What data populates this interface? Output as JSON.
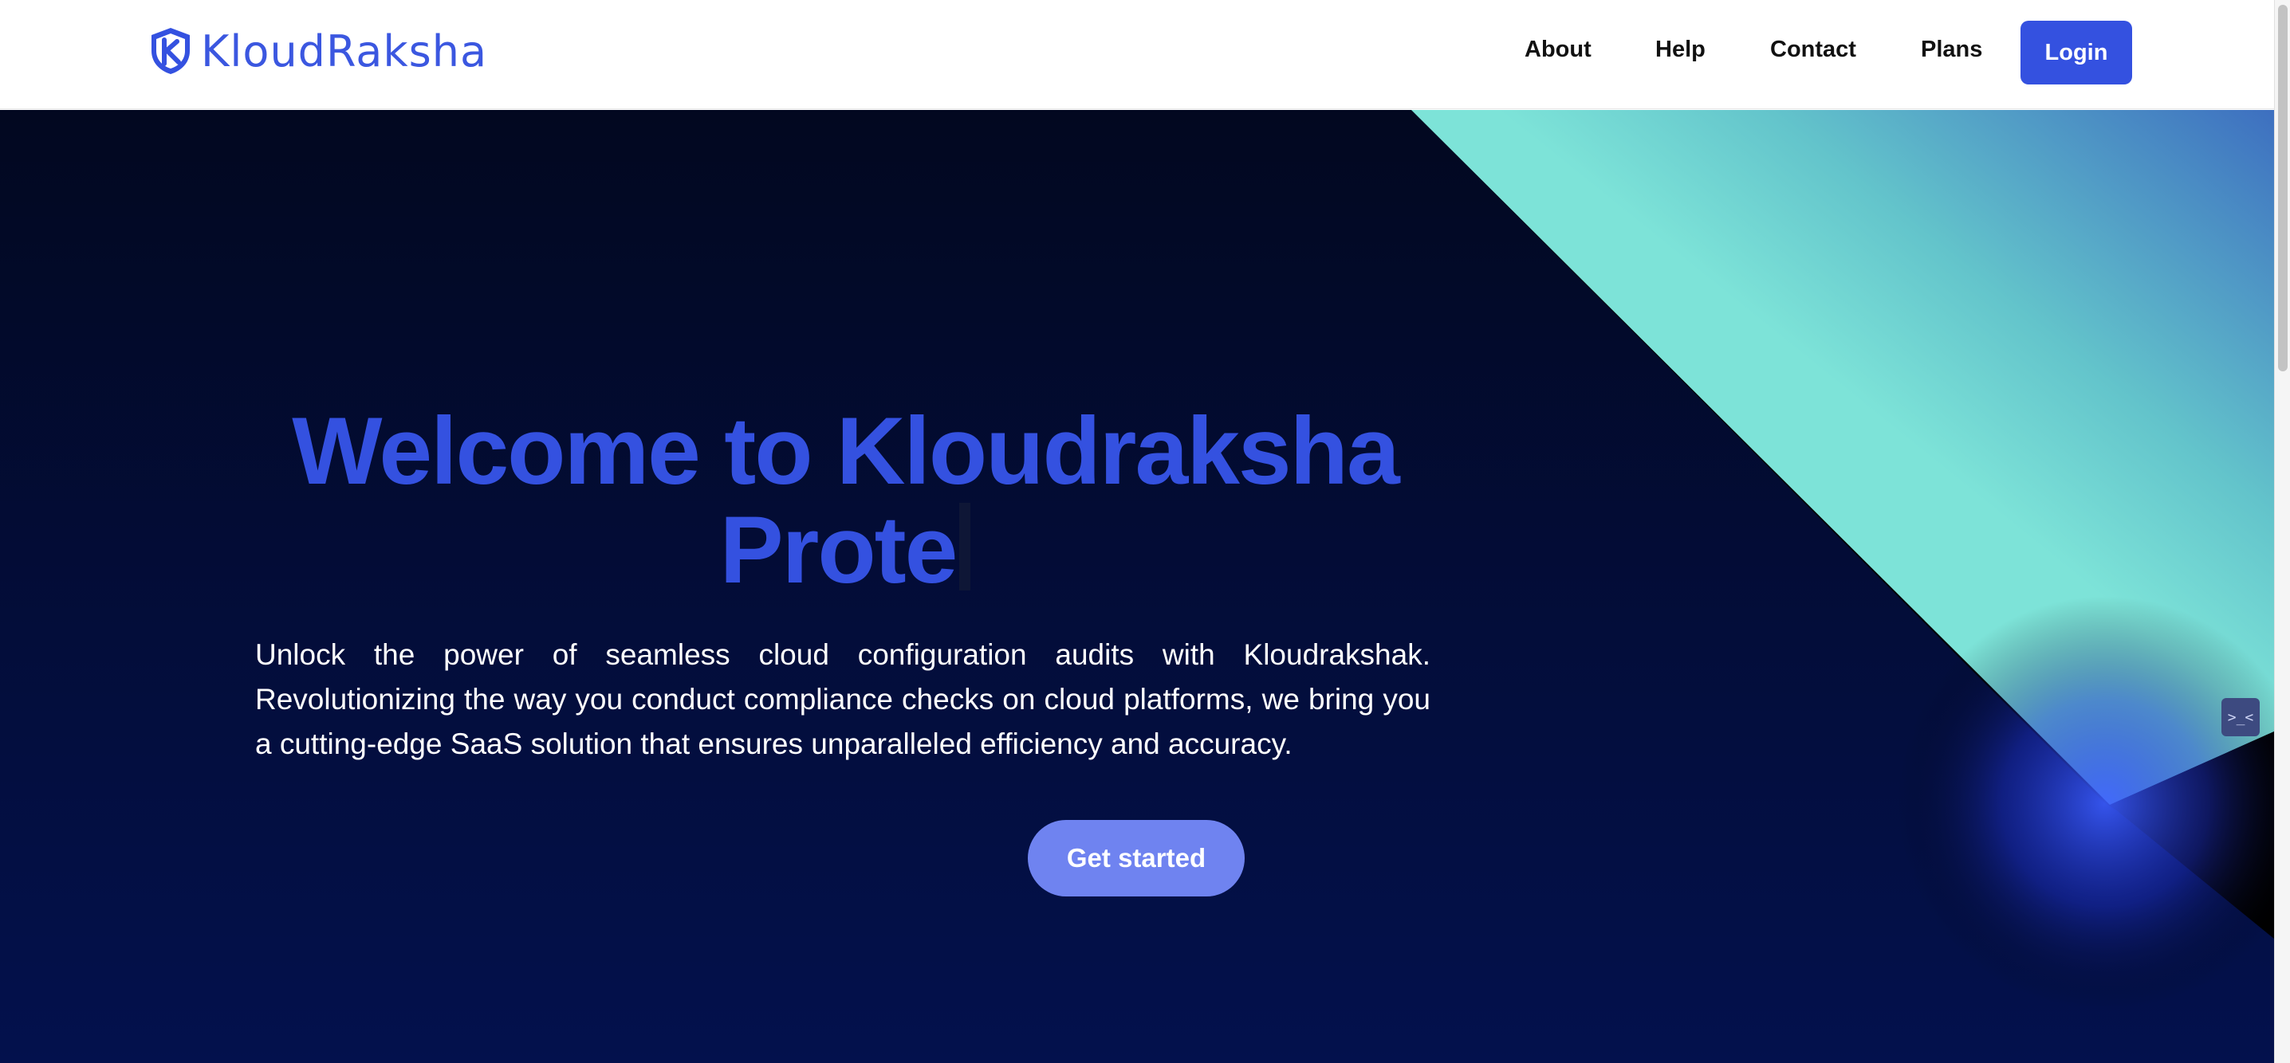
{
  "brand": {
    "name": "KloudRaksha",
    "logo_icon": "shield-icon",
    "accent_color": "#3451e0"
  },
  "nav": {
    "about": "About",
    "help": "Help",
    "contact": "Contact",
    "plans": "Plans",
    "login": "Login"
  },
  "hero": {
    "title_line1": "Welcome to Kloudraksha",
    "title_line2": "Prote",
    "description": "Unlock the power of seamless cloud configuration audits with Kloudrakshak. Revolutionizing the way you conduct compliance checks on cloud platforms, we bring you a cutting-edge SaaS solution that ensures unparalleled efficiency and accuracy.",
    "cta": "Get started"
  },
  "widget": {
    "glyph": ">_<",
    "icon": "terminal-icon"
  }
}
